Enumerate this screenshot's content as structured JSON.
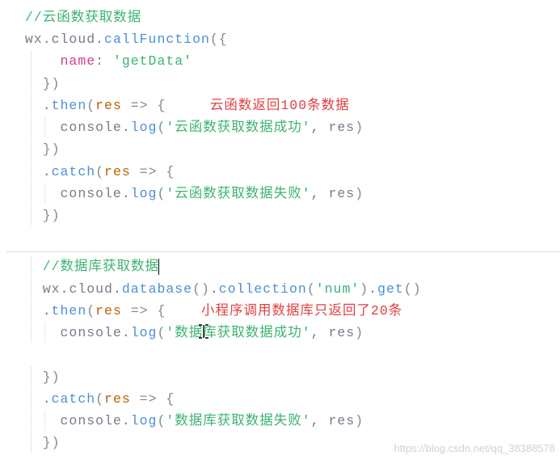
{
  "code": {
    "comment1": "//云函数获取数据",
    "wx": "wx",
    "cloud": "cloud",
    "callFunction": "callFunction",
    "name_key": "name",
    "name_val": "'getData'",
    "then": "then",
    "catch": "catch",
    "res": "res",
    "arrow": "=>",
    "console": "console",
    "log": "log",
    "annotation1": "云函数返回100条数据",
    "str_cloud_success": "'云函数获取数据成功'",
    "str_cloud_fail": "'云函数获取数据失败'",
    "comment2": "//数据库获取数据",
    "database": "database",
    "collection": "collection",
    "num_str": "'num'",
    "get": "get",
    "annotation2": "小程序调用数据库只返回了20条",
    "str_db_success": "'数据库获取数据成功'",
    "str_db_fail": "'数据库获取数据失败'"
  },
  "punct": {
    "open_brace": "{",
    "close_brace": "}",
    "open_paren": "(",
    "close_paren": ")",
    "close_paren_brace": "({",
    "brace_close_paren": "})",
    "colon": ": ",
    "comma": ", ",
    "dot": "."
  },
  "watermark": "https://blog.csdn.net/qq_38388578"
}
